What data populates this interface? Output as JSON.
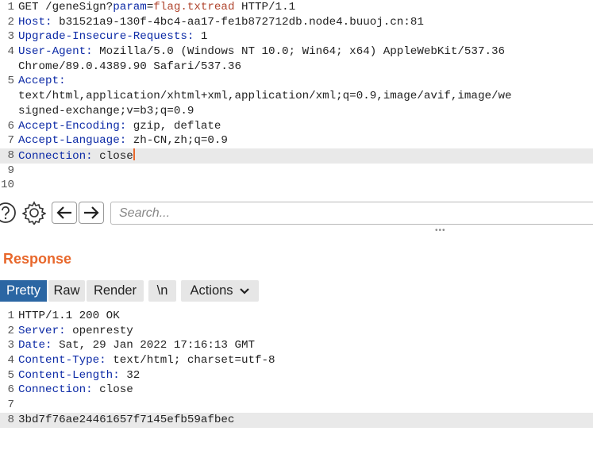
{
  "request": {
    "lines": [
      {
        "n": "1",
        "parts": [
          {
            "t": "GET /geneSign?",
            "c": "hv"
          },
          {
            "t": "param",
            "c": "hp"
          },
          {
            "t": "=",
            "c": "hv"
          },
          {
            "t": "flag.txtread",
            "c": "hq"
          },
          {
            "t": " HTTP/1.1",
            "c": "hv"
          }
        ]
      },
      {
        "n": "2",
        "parts": [
          {
            "t": "Host:",
            "c": "hk"
          },
          {
            "t": " b31521a9-130f-4bc4-aa17-fe1b872712db.node4.buuoj.cn:81",
            "c": "hv"
          }
        ]
      },
      {
        "n": "3",
        "parts": [
          {
            "t": "Upgrade-Insecure-Requests:",
            "c": "hk"
          },
          {
            "t": " 1",
            "c": "hv"
          }
        ]
      },
      {
        "n": "4",
        "parts": [
          {
            "t": "User-Agent:",
            "c": "hk"
          },
          {
            "t": " Mozilla/5.0 (Windows NT 10.0; Win64; x64) AppleWebKit/537.36",
            "c": "hv"
          }
        ]
      },
      {
        "n": "",
        "parts": [
          {
            "t": "Chrome/89.0.4389.90 Safari/537.36",
            "c": "hv"
          }
        ]
      },
      {
        "n": "5",
        "parts": [
          {
            "t": "Accept:",
            "c": "hk"
          }
        ]
      },
      {
        "n": "",
        "parts": [
          {
            "t": "text/html,application/xhtml+xml,application/xml;q=0.9,image/avif,image/we",
            "c": "hv"
          }
        ]
      },
      {
        "n": "",
        "parts": [
          {
            "t": "signed-exchange;v=b3;q=0.9",
            "c": "hv"
          }
        ]
      },
      {
        "n": "6",
        "parts": [
          {
            "t": "Accept-Encoding:",
            "c": "hk"
          },
          {
            "t": " gzip, deflate",
            "c": "hv"
          }
        ]
      },
      {
        "n": "7",
        "parts": [
          {
            "t": "Accept-Language:",
            "c": "hk"
          },
          {
            "t": " zh-CN,zh;q=0.9",
            "c": "hv"
          }
        ]
      },
      {
        "n": "8",
        "highlight": true,
        "cursor": true,
        "parts": [
          {
            "t": "Connection:",
            "c": "hk"
          },
          {
            "t": " close",
            "c": "hv"
          }
        ]
      },
      {
        "n": "9",
        "parts": []
      },
      {
        "n": "10",
        "parts": []
      }
    ]
  },
  "toolbar": {
    "help_icon": "question-circle-icon",
    "settings_icon": "gear-icon",
    "back_icon": "arrow-left-icon",
    "forward_icon": "arrow-right-icon",
    "search_placeholder": "Search..."
  },
  "response": {
    "title": "Response",
    "tabs": {
      "pretty": "Pretty",
      "raw": "Raw",
      "render": "Render",
      "newline": "\\n",
      "actions": "Actions"
    },
    "lines": [
      {
        "n": "1",
        "parts": [
          {
            "t": "HTTP/1.1 200 OK",
            "c": "hv"
          }
        ]
      },
      {
        "n": "2",
        "parts": [
          {
            "t": "Server:",
            "c": "hk"
          },
          {
            "t": " openresty",
            "c": "hv"
          }
        ]
      },
      {
        "n": "3",
        "parts": [
          {
            "t": "Date:",
            "c": "hk"
          },
          {
            "t": " Sat, 29 Jan 2022 17:16:13 GMT",
            "c": "hv"
          }
        ]
      },
      {
        "n": "4",
        "parts": [
          {
            "t": "Content-Type:",
            "c": "hk"
          },
          {
            "t": " text/html; charset=utf-8",
            "c": "hv"
          }
        ]
      },
      {
        "n": "5",
        "parts": [
          {
            "t": "Content-Length:",
            "c": "hk"
          },
          {
            "t": " 32",
            "c": "hv"
          }
        ]
      },
      {
        "n": "6",
        "parts": [
          {
            "t": "Connection:",
            "c": "hk"
          },
          {
            "t": " close",
            "c": "hv"
          }
        ]
      },
      {
        "n": "7",
        "parts": []
      },
      {
        "n": "8",
        "highlight": true,
        "parts": [
          {
            "t": "3bd7f76ae24461657f7145efb59afbec",
            "c": "hv"
          }
        ]
      }
    ]
  },
  "colors": {
    "accent_orange": "#e8682c",
    "active_tab": "#2b66a3",
    "header_key": "#0c2aa6",
    "param_value": "#b0452e",
    "line_highlight": "#e9e9e9"
  }
}
